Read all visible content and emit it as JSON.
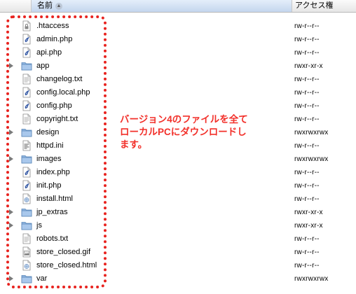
{
  "header": {
    "name": "名前",
    "sort_glyph": "▲",
    "permissions": "アクセス権"
  },
  "files": [
    {
      "name": ".htaccess",
      "perm": "rw-r--r--",
      "icon": "lock-file-icon",
      "folder": false
    },
    {
      "name": "admin.php",
      "perm": "rw-r--r--",
      "icon": "php-file-icon",
      "folder": false
    },
    {
      "name": "api.php",
      "perm": "rw-r--r--",
      "icon": "php-file-icon",
      "folder": false
    },
    {
      "name": "app",
      "perm": "rwxr-xr-x",
      "icon": "folder-icon",
      "folder": true
    },
    {
      "name": "changelog.txt",
      "perm": "rw-r--r--",
      "icon": "text-file-icon",
      "folder": false
    },
    {
      "name": "config.local.php",
      "perm": "rw-r--r--",
      "icon": "php-file-icon",
      "folder": false
    },
    {
      "name": "config.php",
      "perm": "rw-r--r--",
      "icon": "php-file-icon",
      "folder": false
    },
    {
      "name": "copyright.txt",
      "perm": "rw-r--r--",
      "icon": "text-file-icon",
      "folder": false
    },
    {
      "name": "design",
      "perm": "rwxrwxrwx",
      "icon": "folder-icon",
      "folder": true
    },
    {
      "name": "httpd.ini",
      "perm": "rw-r--r--",
      "icon": "ini-file-icon",
      "folder": false
    },
    {
      "name": "images",
      "perm": "rwxrwxrwx",
      "icon": "folder-icon",
      "folder": true
    },
    {
      "name": "index.php",
      "perm": "rw-r--r--",
      "icon": "php-file-icon",
      "folder": false
    },
    {
      "name": "init.php",
      "perm": "rw-r--r--",
      "icon": "php-file-icon",
      "folder": false
    },
    {
      "name": "install.html",
      "perm": "rw-r--r--",
      "icon": "html-file-icon",
      "folder": false
    },
    {
      "name": "jp_extras",
      "perm": "rwxr-xr-x",
      "icon": "folder-icon",
      "folder": true
    },
    {
      "name": "js",
      "perm": "rwxr-xr-x",
      "icon": "folder-icon",
      "folder": true
    },
    {
      "name": "robots.txt",
      "perm": "rw-r--r--",
      "icon": "text-file-icon",
      "folder": false
    },
    {
      "name": "store_closed.gif",
      "perm": "rw-r--r--",
      "icon": "image-file-icon",
      "folder": false
    },
    {
      "name": "store_closed.html",
      "perm": "rw-r--r--",
      "icon": "html-file-icon",
      "folder": false
    },
    {
      "name": "var",
      "perm": "rwxrwxrwx",
      "icon": "folder-icon",
      "folder": true
    }
  ],
  "annotation": {
    "lines": [
      "バージョン4のファイルを全て",
      "ローカルPCにダウンロードし",
      "ます。"
    ],
    "color": "#f2302a"
  },
  "colors": {
    "highlight_border": "#e8231f",
    "folder_blue": "#8fb6e0"
  }
}
